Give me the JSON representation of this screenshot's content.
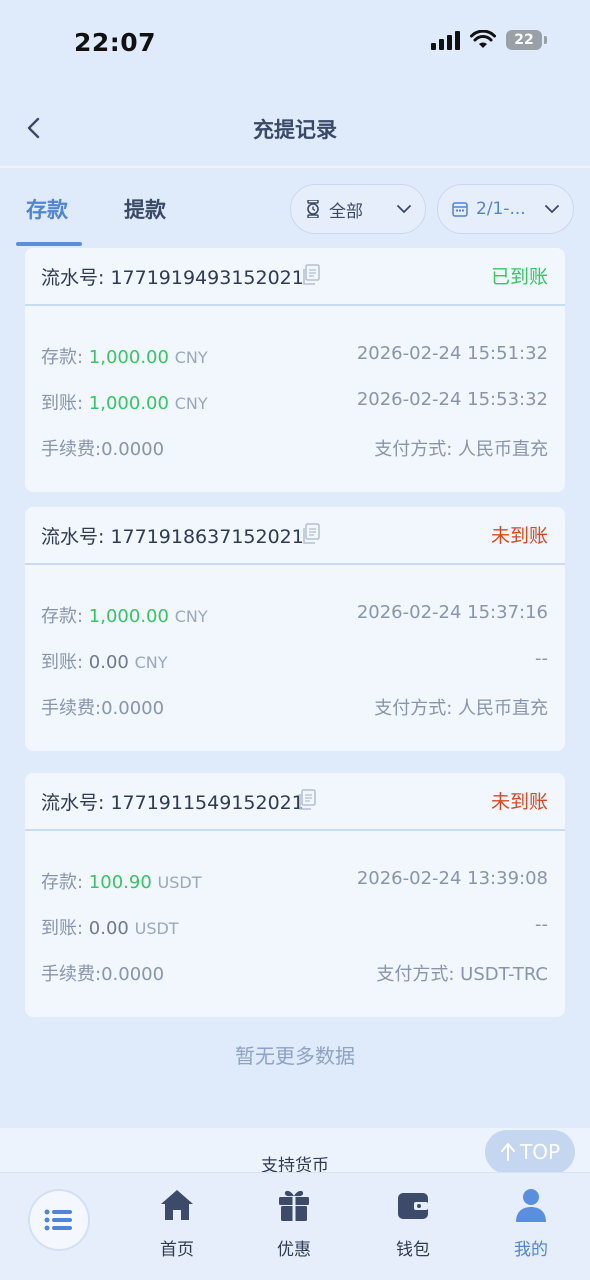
{
  "status_bar": {
    "time": "22:07",
    "battery": "22"
  },
  "header": {
    "title": "充提记录"
  },
  "tabs": [
    {
      "label": "存款",
      "active": true
    },
    {
      "label": "提款",
      "active": false
    }
  ],
  "filters": {
    "status": "全部",
    "date": "2/1-..."
  },
  "records": [
    {
      "serial": "流水号: 1771919493152021",
      "status": "已到账",
      "deposit_label": "存款: ",
      "deposit_amount": "1,000.00",
      "deposit_currency": "CNY",
      "deposit_time": "2026-02-24 15:51:32",
      "arrival_label": "到账: ",
      "arrival_amount": "1,000.00",
      "arrival_currency": "CNY",
      "arrival_time": "2026-02-24 15:53:32",
      "fee": "手续费:0.0000",
      "payment": "支付方式: 人民币直充"
    },
    {
      "serial": "流水号: 1771918637152021",
      "status": "未到账",
      "deposit_label": "存款: ",
      "deposit_amount": "1,000.00",
      "deposit_currency": "CNY",
      "deposit_time": "2026-02-24 15:37:16",
      "arrival_label": "到账: ",
      "arrival_amount": "0.00",
      "arrival_currency": "CNY",
      "arrival_time": "--",
      "fee": "手续费:0.0000",
      "payment": "支付方式: 人民币直充"
    },
    {
      "serial": "流水号: 1771911549152021",
      "status": "未到账",
      "deposit_label": "存款: ",
      "deposit_amount": "100.90",
      "deposit_currency": "USDT",
      "deposit_time": "2026-02-24 13:39:08",
      "arrival_label": "到账: ",
      "arrival_amount": "0.00",
      "arrival_currency": "USDT",
      "arrival_time": "--",
      "fee": "手续费:0.0000",
      "payment": "支付方式: USDT-TRC"
    }
  ],
  "no_more_text": "暂无更多数据",
  "support_text": "支持货币",
  "top_button": "TOP",
  "nav": {
    "home": "首页",
    "promo": "优惠",
    "wallet": "钱包",
    "mine": "我的"
  },
  "colors": {
    "accent": "#4f84d6",
    "success": "#35c764",
    "pending": "#d9481f",
    "background": "#dfeafb"
  }
}
